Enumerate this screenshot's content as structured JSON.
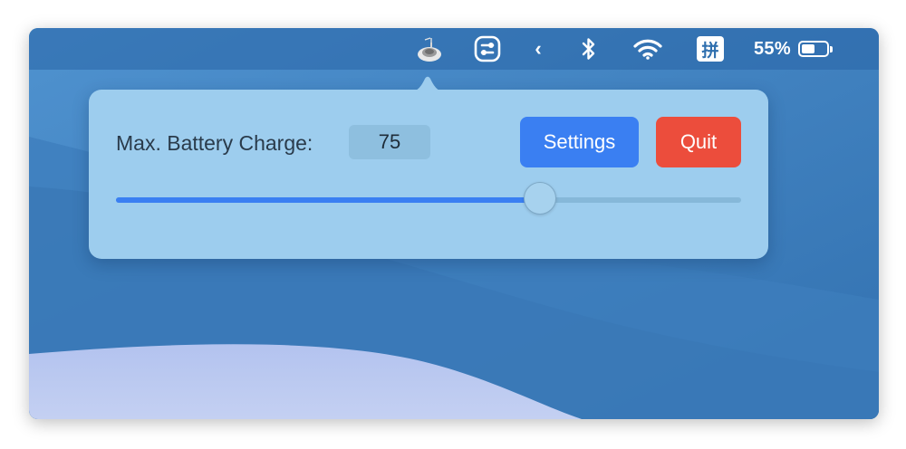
{
  "menubar": {
    "app_icon": "al-dente-app-icon",
    "control_icon": "control-center-icon",
    "collapse_chevron": "‹",
    "bluetooth_icon": "bluetooth-icon",
    "wifi_icon": "wifi-icon",
    "input_method": "拼",
    "battery": {
      "percent_label": "55%",
      "level": 0.55
    }
  },
  "popover": {
    "label": "Max. Battery Charge:",
    "value": "75",
    "settings_button": "Settings",
    "quit_button": "Quit",
    "slider": {
      "value": 75,
      "min": 20,
      "max": 100
    }
  },
  "colors": {
    "accent": "#3a7ff2",
    "quit": "#ec4d3c",
    "popover_bg": "#9dcdee",
    "wallpaper": "#3f7fbd"
  }
}
